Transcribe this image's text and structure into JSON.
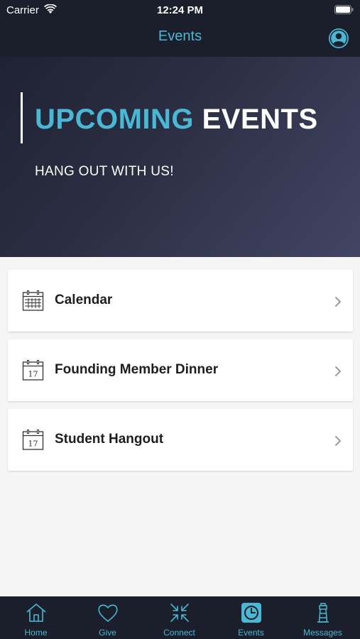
{
  "status_bar": {
    "carrier": "Carrier",
    "time": "12:24 PM"
  },
  "nav": {
    "title": "Events",
    "profile_icon": "person-circle-icon"
  },
  "hero": {
    "title_accent": "UPCOMING",
    "title_plain": "EVENTS",
    "subtitle": "HANG OUT WITH US!"
  },
  "list": {
    "items": [
      {
        "label": "Calendar",
        "icon": "calendar-grid-icon"
      },
      {
        "label": "Founding Member Dinner",
        "icon": "calendar-day-icon",
        "day": "17"
      },
      {
        "label": "Student Hangout",
        "icon": "calendar-day-icon",
        "day": "17"
      }
    ]
  },
  "tab_bar": {
    "active": "Events",
    "tabs": [
      {
        "label": "Home",
        "icon": "home-icon"
      },
      {
        "label": "Give",
        "icon": "heart-icon"
      },
      {
        "label": "Connect",
        "icon": "arrows-in-icon"
      },
      {
        "label": "Events",
        "icon": "clock-icon"
      },
      {
        "label": "Messages",
        "icon": "lighthouse-icon"
      }
    ]
  },
  "colors": {
    "accent": "#4ab8d4",
    "dark": "#1b1e2b",
    "background": "#f5f5f5"
  }
}
